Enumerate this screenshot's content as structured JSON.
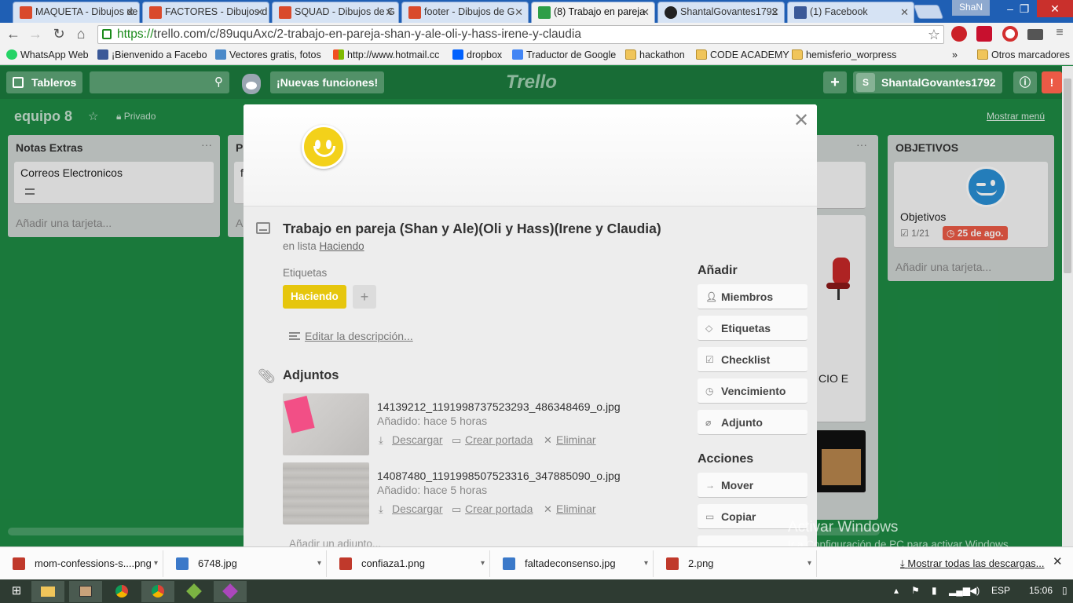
{
  "browser": {
    "tabs": [
      {
        "title": "MAQUETA - Dibujos de",
        "favicon_color": "#d94a2b"
      },
      {
        "title": "FACTORES - Dibujos d",
        "favicon_color": "#d94a2b"
      },
      {
        "title": "SQUAD - Dibujos de G",
        "favicon_color": "#d94a2b"
      },
      {
        "title": "footer - Dibujos de G",
        "favicon_color": "#d94a2b"
      },
      {
        "title": "(8) Trabajo en pareja",
        "favicon_color": "#2e9e47",
        "active": true
      },
      {
        "title": "ShantalGovantes1792",
        "favicon_color": "#222222"
      },
      {
        "title": "(1) Facebook",
        "favicon_color": "#3b5998"
      }
    ],
    "profile_name": "ShaN",
    "url_scheme": "https://",
    "url_rest": "trello.com/c/89uquAxc/2-trabajo-en-pareja-shan-y-ale-oli-y-hass-irene-y-claudia",
    "bookmarks": [
      {
        "label": "WhatsApp Web",
        "icon": "whatsapp-icon"
      },
      {
        "label": "¡Bienvenido a Facebo",
        "icon": "facebook-icon"
      },
      {
        "label": "Vectores gratis, fotos",
        "icon": "freepik-icon"
      },
      {
        "label": "http://www.hotmail.cc",
        "icon": "windows-icon"
      },
      {
        "label": "dropbox",
        "icon": "dropbox-icon"
      },
      {
        "label": "Traductor de Google",
        "icon": "translate-icon"
      },
      {
        "label": "hackathon",
        "icon": "folder-icon"
      },
      {
        "label": "CODE ACADEMY",
        "icon": "folder-icon"
      },
      {
        "label": "hemisferio_worpress",
        "icon": "folder-icon"
      }
    ],
    "bookmarks_overflow": "»",
    "other_bookmarks": "Otros marcadores"
  },
  "trello": {
    "boards_button": "Tableros",
    "new_features": "¡Nuevas funciones!",
    "logo": "Trello",
    "user_initial": "S",
    "username": "ShantalGovantes1792",
    "board_title": "equipo 8",
    "board_visibility": "Privado",
    "show_menu": "Mostrar menú",
    "lists": [
      {
        "title": "Notas Extras",
        "cards": [
          "Correos Electronicos"
        ],
        "add_card": "Añadir una tarjeta..."
      },
      {
        "title": "P",
        "cards": [
          "f"
        ],
        "add_card": "A"
      },
      {
        "title": "OBJETIVOS",
        "cards": [
          "Objetivos"
        ],
        "checklist": "1/21",
        "due": "25 de ago.",
        "add_card": "Añadir una tarjeta..."
      }
    ],
    "partial_card_text": "CIO E"
  },
  "card_modal": {
    "title": "Trabajo en pareja (Shan y Ale)(Oli y Hass)(Irene y Claudia)",
    "in_list_prefix": "en lista",
    "list_name": "Haciendo",
    "labels_heading": "Etiquetas",
    "labels": [
      "Haciendo"
    ],
    "label_color": "#e6c60d",
    "add_label": "+",
    "edit_description": "Editar la descripción...",
    "attachments_heading": "Adjuntos",
    "attachments": [
      {
        "filename": "14139212_1191998737523293_486348469_o.jpg",
        "added": "Añadido: hace 5 horas"
      },
      {
        "filename": "14087480_1191998507523316_347885090_o.jpg",
        "added": "Añadido: hace 5 horas"
      }
    ],
    "attachment_actions": {
      "download": "Descargar",
      "make_cover": "Crear portada",
      "remove": "Eliminar"
    },
    "add_attachment": "Añadir un adjunto...",
    "add_heading": "Añadir",
    "add_buttons": [
      {
        "label": "Miembros",
        "icon": "person-icon"
      },
      {
        "label": "Etiquetas",
        "icon": "tag-icon"
      },
      {
        "label": "Checklist",
        "icon": "checkbox-icon"
      },
      {
        "label": "Vencimiento",
        "icon": "clock-icon"
      },
      {
        "label": "Adjunto",
        "icon": "paperclip-icon"
      }
    ],
    "actions_heading": "Acciones",
    "action_buttons": [
      {
        "label": "Mover",
        "icon": "arrow-right-icon"
      },
      {
        "label": "Copiar",
        "icon": "card-icon"
      }
    ]
  },
  "watermark": {
    "line1": "Activar Windows",
    "line2": "Ir a Configuración de PC para activar Windows."
  },
  "downloads": {
    "items": [
      "mom-confessions-s....png",
      "6748.jpg",
      "confiaza1.png",
      "faltadeconsenso.jpg",
      "2.png"
    ],
    "show_all": "Mostrar todas las descargas..."
  },
  "taskbar": {
    "language": "ESP",
    "time": "15:06"
  }
}
